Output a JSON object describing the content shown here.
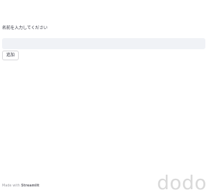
{
  "form": {
    "name_label": "名前を入力してください",
    "name_value": "",
    "add_button_label": "追加"
  },
  "footer": {
    "made_with": "Made with",
    "brand": "Streamlit"
  },
  "watermark": {
    "text": "dodo"
  },
  "colors": {
    "input_background": "#f0f2f6",
    "button_border": "#d6d6d9",
    "text": "#31333f",
    "footer_text": "#9a9aa0",
    "watermark": "#d9d9d9"
  }
}
